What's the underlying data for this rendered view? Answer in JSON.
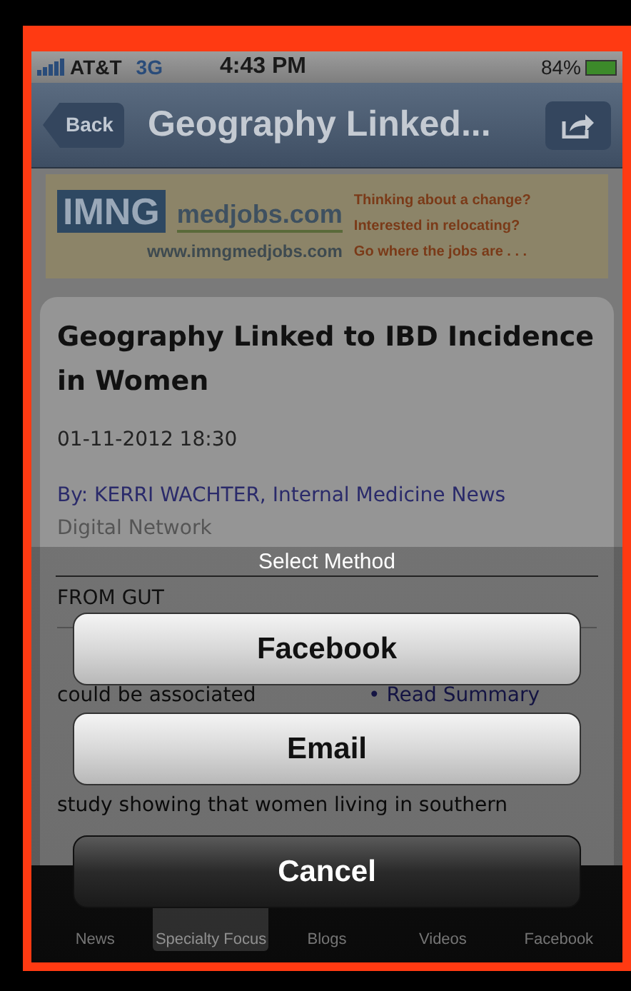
{
  "status_bar": {
    "carrier": "AT&T",
    "network": "3G",
    "time": "4:43 PM",
    "battery": "84%"
  },
  "nav_bar": {
    "back": "Back",
    "title": "Geography Linked..."
  },
  "ad": {
    "logo": "IMNG",
    "brand": "medjobs.com",
    "url": "www.imngmedjobs.com",
    "lines": [
      "Thinking about a change?",
      "Interested in relocating?",
      "Go where the jobs are . . ."
    ]
  },
  "article": {
    "title": "Geography Linked to IBD Incidence in Women",
    "date": "01-11-2012 18:30",
    "byline": "By: KERRI WACHTER, Internal Medicine News",
    "byline_cont": "Digital Network",
    "section": "FROM GUT",
    "body_fragment": "could be associated",
    "summary_link": "• Read Summary",
    "body_line": "study showing that women living in southern"
  },
  "action_sheet": {
    "title": "Select Method",
    "buttons": [
      {
        "label": "Facebook",
        "kind": "default"
      },
      {
        "label": "Email",
        "kind": "default"
      },
      {
        "label": "Cancel",
        "kind": "cancel"
      }
    ]
  },
  "tab_bar": [
    {
      "label": "News",
      "selected": false
    },
    {
      "label": "Specialty Focus",
      "selected": true
    },
    {
      "label": "Blogs",
      "selected": false
    },
    {
      "label": "Videos",
      "selected": false
    },
    {
      "label": "Facebook",
      "selected": false
    }
  ]
}
